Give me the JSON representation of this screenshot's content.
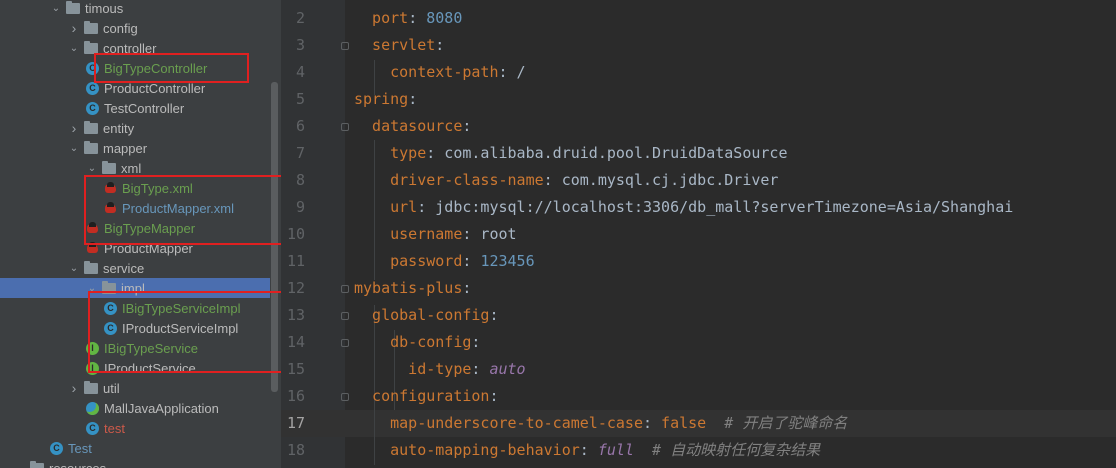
{
  "tree": {
    "items": [
      {
        "label": "timous",
        "kind": "folder",
        "chev": "v"
      },
      {
        "label": "config",
        "kind": "folder",
        "chev": ">"
      },
      {
        "label": "controller",
        "kind": "folder",
        "chev": "v"
      },
      {
        "label": "BigTypeController",
        "kind": "class",
        "color": "green"
      },
      {
        "label": "ProductController",
        "kind": "class"
      },
      {
        "label": "TestController",
        "kind": "class"
      },
      {
        "label": "entity",
        "kind": "folder",
        "chev": ">"
      },
      {
        "label": "mapper",
        "kind": "folder",
        "chev": "v"
      },
      {
        "label": "xml",
        "kind": "folder",
        "chev": "v"
      },
      {
        "label": "BigType.xml",
        "kind": "xml",
        "color": "green"
      },
      {
        "label": "ProductMapper.xml",
        "kind": "xml",
        "color": "blue"
      },
      {
        "label": "BigTypeMapper",
        "kind": "mapper",
        "color": "green"
      },
      {
        "label": "ProductMapper",
        "kind": "mapper"
      },
      {
        "label": "service",
        "kind": "folder",
        "chev": "v"
      },
      {
        "label": "impl",
        "kind": "folder",
        "chev": "v"
      },
      {
        "label": "IBigTypeServiceImpl",
        "kind": "class",
        "color": "green"
      },
      {
        "label": "IProductServiceImpl",
        "kind": "class"
      },
      {
        "label": "IBigTypeService",
        "kind": "interface",
        "color": "green"
      },
      {
        "label": "IProductService",
        "kind": "interface"
      },
      {
        "label": "util",
        "kind": "folder",
        "chev": ">"
      },
      {
        "label": "MallJavaApplication",
        "kind": "app"
      },
      {
        "label": "test",
        "kind": "class",
        "color": "red"
      },
      {
        "label": "Test",
        "kind": "class",
        "color": "blue"
      },
      {
        "label": "resources",
        "kind": "folder",
        "chev": "v"
      }
    ]
  },
  "editor": {
    "line_numbers": [
      "2",
      "3",
      "4",
      "5",
      "6",
      "7",
      "8",
      "9",
      "10",
      "11",
      "12",
      "13",
      "14",
      "15",
      "16",
      "17",
      "18"
    ],
    "active_line": "17",
    "lines": [
      [
        {
          "t": "  port",
          "c": "k"
        },
        {
          "t": ": ",
          "c": "p"
        },
        {
          "t": "8080",
          "c": "n"
        }
      ],
      [
        {
          "t": "  servlet",
          "c": "k"
        },
        {
          "t": ":",
          "c": "p"
        }
      ],
      [
        {
          "t": "    context-path",
          "c": "k"
        },
        {
          "t": ": /",
          "c": "p"
        }
      ],
      [
        {
          "t": "spring",
          "c": "k"
        },
        {
          "t": ":",
          "c": "p"
        }
      ],
      [
        {
          "t": "  datasource",
          "c": "k"
        },
        {
          "t": ":",
          "c": "p"
        }
      ],
      [
        {
          "t": "    type",
          "c": "k"
        },
        {
          "t": ": com.alibaba.druid.pool.DruidDataSource",
          "c": "p"
        }
      ],
      [
        {
          "t": "    driver-class-name",
          "c": "k"
        },
        {
          "t": ": com.mysql.cj.jdbc.Driver",
          "c": "p"
        }
      ],
      [
        {
          "t": "    url",
          "c": "k"
        },
        {
          "t": ": jdbc:mysql://localhost:3306/db_mall?serverTimezone=Asia/Shanghai",
          "c": "p"
        }
      ],
      [
        {
          "t": "    username",
          "c": "k"
        },
        {
          "t": ": root",
          "c": "p"
        }
      ],
      [
        {
          "t": "    password",
          "c": "k"
        },
        {
          "t": ": ",
          "c": "p"
        },
        {
          "t": "123456",
          "c": "n"
        }
      ],
      [
        {
          "t": "mybatis-plus",
          "c": "k"
        },
        {
          "t": ":",
          "c": "p"
        }
      ],
      [
        {
          "t": "  global-config",
          "c": "k"
        },
        {
          "t": ":",
          "c": "p"
        }
      ],
      [
        {
          "t": "    db-config",
          "c": "k"
        },
        {
          "t": ":",
          "c": "p"
        }
      ],
      [
        {
          "t": "      id-type",
          "c": "k"
        },
        {
          "t": ": ",
          "c": "p"
        },
        {
          "t": "auto",
          "c": "it"
        }
      ],
      [
        {
          "t": "  configuration",
          "c": "k"
        },
        {
          "t": ":",
          "c": "p"
        }
      ],
      [
        {
          "t": "    map-underscore-to-camel-case",
          "c": "k"
        },
        {
          "t": ": ",
          "c": "p"
        },
        {
          "t": "false",
          "c": "k"
        },
        {
          "t": "  # 开启了驼峰命名",
          "c": "cm"
        }
      ],
      [
        {
          "t": "    auto-mapping-behavior",
          "c": "k"
        },
        {
          "t": ": ",
          "c": "p"
        },
        {
          "t": "full",
          "c": "it"
        },
        {
          "t": "  # 自动映射任何复杂结果",
          "c": "cm"
        }
      ]
    ]
  }
}
